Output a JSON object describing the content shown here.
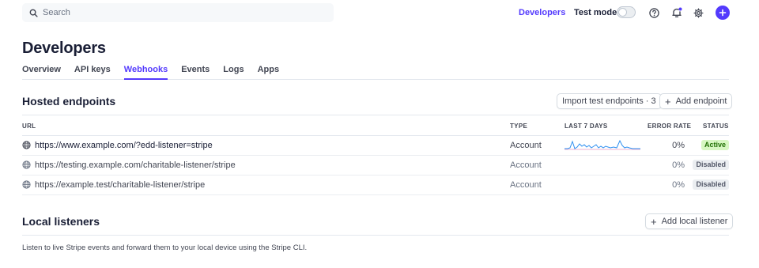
{
  "topbar": {
    "search_placeholder": "Search",
    "developers_link": "Developers",
    "test_mode_label": "Test mode",
    "test_mode_on": false,
    "icons": [
      "search-icon",
      "help-icon",
      "notifications-icon",
      "settings-icon",
      "create-icon"
    ],
    "accent_color": "#533afd"
  },
  "page": {
    "title": "Developers",
    "tabs": [
      {
        "label": "Overview",
        "active": false
      },
      {
        "label": "API keys",
        "active": false
      },
      {
        "label": "Webhooks",
        "active": true
      },
      {
        "label": "Events",
        "active": false
      },
      {
        "label": "Logs",
        "active": false
      },
      {
        "label": "Apps",
        "active": false
      }
    ]
  },
  "hosted": {
    "title": "Hosted endpoints",
    "import_button": "Import test endpoints · 3",
    "add_button": "Add endpoint",
    "columns": {
      "url": "URL",
      "type": "TYPE",
      "last7": "LAST 7 DAYS",
      "error_rate": "ERROR RATE",
      "status": "STATUS"
    },
    "rows": [
      {
        "url": "https://www.example.com/?edd-listener=stripe",
        "type": "Account",
        "error_rate": "0%",
        "status": "Active",
        "has_chart": true
      },
      {
        "url": "https://testing.example.com/charitable-listener/stripe",
        "type": "Account",
        "error_rate": "0%",
        "status": "Disabled",
        "has_chart": false
      },
      {
        "url": "https://example.test/charitable-listener/stripe",
        "type": "Account",
        "error_rate": "0%",
        "status": "Disabled",
        "has_chart": false
      }
    ],
    "status_colors": {
      "Active": "#217005",
      "Disabled": "#545969"
    }
  },
  "local": {
    "title": "Local listeners",
    "add_button": "Add local listener",
    "description": "Listen to live Stripe events and forward them to your local device using the Stripe CLI."
  }
}
